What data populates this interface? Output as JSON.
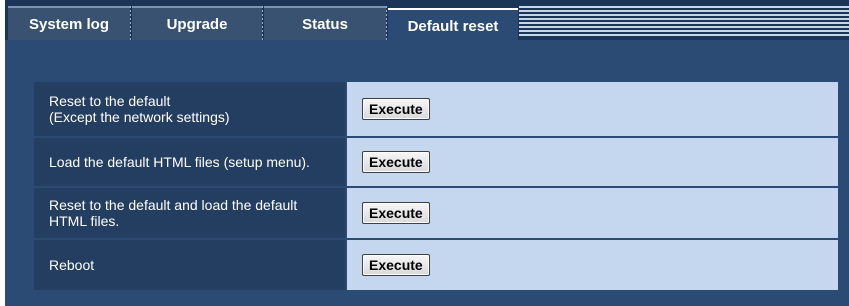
{
  "tabs": [
    {
      "label": "System log"
    },
    {
      "label": "Upgrade"
    },
    {
      "label": "Status"
    },
    {
      "label": "Default reset",
      "active": true
    }
  ],
  "rows": [
    {
      "label_line1": "Reset to the default",
      "label_line2": "(Except the network settings)",
      "button": "Execute"
    },
    {
      "label_line1": "Load the default HTML files (setup menu).",
      "label_line2": "",
      "button": "Execute"
    },
    {
      "label_line1": "Reset to the default and load the default",
      "label_line2": "HTML files.",
      "button": "Execute"
    },
    {
      "label_line1": "Reboot",
      "label_line2": "",
      "button": "Execute"
    }
  ],
  "colors": {
    "background": "#233e60",
    "panel": "#2b4a74",
    "action_cell": "#c5d7ee"
  }
}
